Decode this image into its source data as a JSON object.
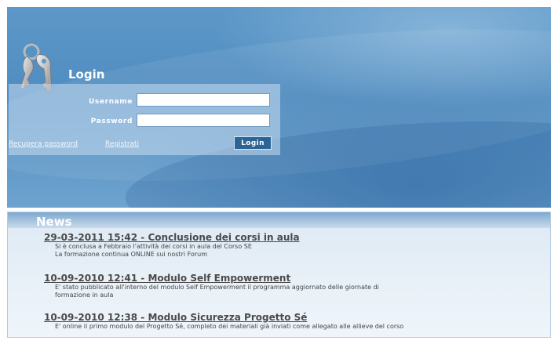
{
  "login": {
    "title": "Login",
    "username_label": "Username",
    "password_label": "Password",
    "username_value": "",
    "password_value": "",
    "recover_link": "Recupera password",
    "register_link": "Registrati",
    "submit_label": "Login"
  },
  "news": {
    "title": "News",
    "items": [
      {
        "headline": "29-03-2011 15:42 - Conclusione dei corsi in aula",
        "lines": [
          "Si è conclusa a Febbraio l'attività dei corsi in aula del Corso SE",
          "La formazione continua ONLINE sui nostri Forum"
        ]
      },
      {
        "headline": "10-09-2010 12:41 - Modulo Self Empowerment",
        "lines": [
          "E' stato pubblicato all'interno del modulo Self Empowerment il programma aggiornato delle giornate di",
          "formazione in aula"
        ]
      },
      {
        "headline": "10-09-2010 12:38 - Modulo Sicurezza Progetto Sé",
        "lines": [
          "E' online il primo modulo del Progetto Sé, completo dei materiali  già inviati come allegato alle allieve del corso"
        ]
      }
    ]
  }
}
